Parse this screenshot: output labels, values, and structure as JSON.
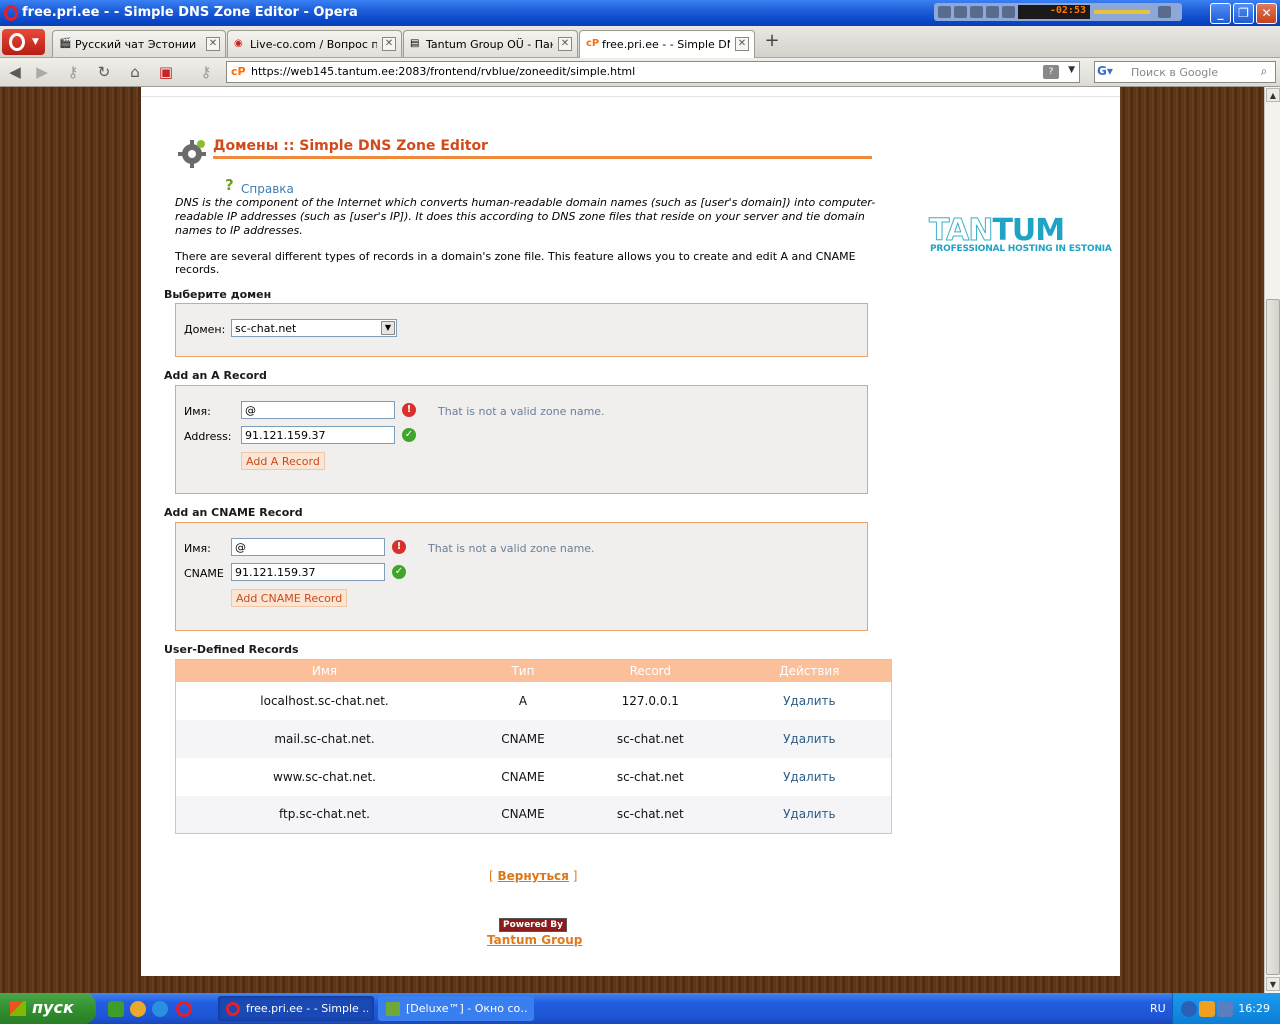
{
  "window": {
    "title": "free.pri.ee - - Simple DNS Zone Editor - Opera",
    "media_time": "-02:53"
  },
  "tabs": [
    {
      "label": "Русский чат Эстонии",
      "icon": "film-icon"
    },
    {
      "label": "Live-co.com / Вопрос пр…",
      "icon": "globe-icon"
    },
    {
      "label": "Tantum Group OÜ - Пан…",
      "icon": "page-icon"
    },
    {
      "label": "free.pri.ee - - Simple DN…",
      "icon": "cpanel-icon"
    }
  ],
  "address": {
    "favicon": "cP",
    "url": "https://web145.tantum.ee:2083/frontend/rvblue/zoneedit/simple.html",
    "search_placeholder": "Поиск в Google"
  },
  "page": {
    "title": "Домены :: Simple DNS Zone Editor",
    "help_icon": "?",
    "help": "Справка",
    "desc1": "DNS is the component of the Internet which converts human-readable domain names (such as [user's domain]) into computer-readable IP addresses (such as [user's IP]). It does this according to DNS zone files that reside on your server and tie domain names to IP addresses.",
    "desc2": "There are several different types of records in a domain's zone file. This feature allows you to create and edit A and CNAME records.",
    "logo": {
      "tan": "TAN",
      "tum": "TUM",
      "tag": "PROFESSIONAL HOSTING IN ESTONIA"
    },
    "select_domain": {
      "title": "Выберите домен",
      "label": "Домен:",
      "value": "sc-chat.net"
    },
    "a_record": {
      "title": "Add an A Record",
      "name_label": "Имя:",
      "name_value": "@",
      "name_error": "That is not a valid zone name.",
      "address_label": "Address:",
      "address_value": "91.121.159.37",
      "button": "Add A Record"
    },
    "cname_record": {
      "title": "Add an CNAME Record",
      "name_label": "Имя:",
      "name_value": "@",
      "name_error": "That is not a valid zone name.",
      "cname_label": "CNAME",
      "cname_value": "91.121.159.37",
      "button": "Add CNAME Record"
    },
    "records": {
      "title": "User-Defined Records",
      "headers": [
        "Имя",
        "Тип",
        "Record",
        "Действия"
      ],
      "rows": [
        {
          "name": "localhost.sc-chat.net.",
          "type": "A",
          "record": "127.0.0.1",
          "action": "Удалить"
        },
        {
          "name": "mail.sc-chat.net.",
          "type": "CNAME",
          "record": "sc-chat.net",
          "action": "Удалить"
        },
        {
          "name": "www.sc-chat.net.",
          "type": "CNAME",
          "record": "sc-chat.net",
          "action": "Удалить"
        },
        {
          "name": "ftp.sc-chat.net.",
          "type": "CNAME",
          "record": "sc-chat.net",
          "action": "Удалить"
        }
      ]
    },
    "back_open": "[",
    "back": "Вернуться",
    "back_close": "]",
    "powered_by": "Powered By",
    "powered_name": "Tantum Group"
  },
  "taskbar": {
    "start": "пуск",
    "tasks": [
      {
        "label": "free.pri.ee - - Simple …",
        "icon": "opera-icon"
      },
      {
        "label": "[Deluxe™] - Окно со…",
        "icon": "chat-icon"
      }
    ],
    "lang": "RU",
    "clock": "16:29"
  },
  "colors": {
    "title_orange": "#d24a1a",
    "accent_line": "#f08a3a",
    "table_header": "#fbbf9a",
    "link_blue": "#2c5c86"
  }
}
